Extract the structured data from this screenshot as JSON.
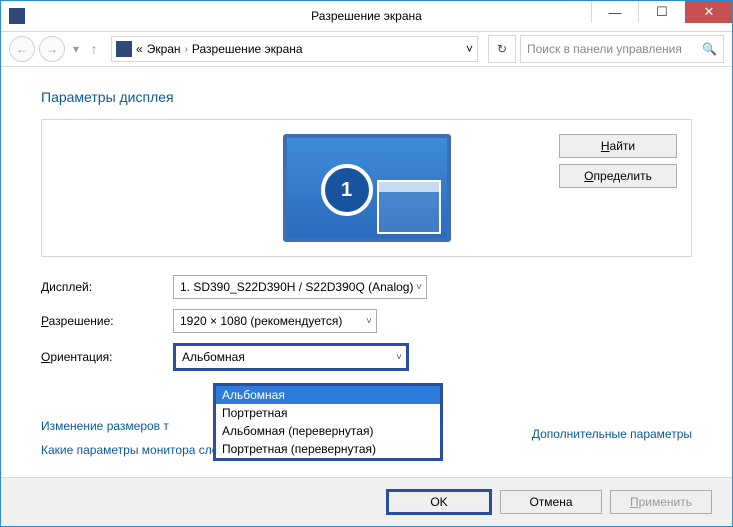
{
  "window": {
    "title": "Разрешение экрана",
    "min": "—",
    "max": "☐",
    "close": "✕"
  },
  "nav": {
    "back": "←",
    "fwd": "→",
    "dd": "▾",
    "up": "↑",
    "crumb_prefix": "«",
    "crumb1": "Экран",
    "sep": "›",
    "crumb2": "Разрешение экрана",
    "addr_dd": "˅",
    "refresh": "↻",
    "search_placeholder": "Поиск в панели управления",
    "search_icon": "🔍"
  },
  "page": {
    "heading": "Параметры дисплея",
    "monitor_number": "1",
    "btn_find": "айти",
    "btn_find_u": "Н",
    "btn_detect": "пределить",
    "btn_detect_u": "О"
  },
  "rows": {
    "display_label": "исплей:",
    "display_u": "Д",
    "display_value": "1. SD390_S22D390H / S22D390Q (Analog)",
    "resolution_label": "азрешение:",
    "resolution_u": "Р",
    "resolution_value": "1920 × 1080 (рекомендуется)",
    "orientation_label": "риентация:",
    "orientation_u": "О",
    "orientation_value": "Альбомная"
  },
  "dropdown": {
    "opt1": "Альбомная",
    "opt2": "Портретная",
    "opt3": "Альбомная (перевернутая)",
    "opt4": "Портретная (перевернутая)"
  },
  "links": {
    "advanced": "Дополнительные параметры",
    "resize_text": "Изменение размеров т",
    "which_params": "Какие параметры монитора следует выбрать?"
  },
  "footer": {
    "ok": "OK",
    "cancel": "Отмена",
    "apply_u": "П",
    "apply": "рименить"
  }
}
